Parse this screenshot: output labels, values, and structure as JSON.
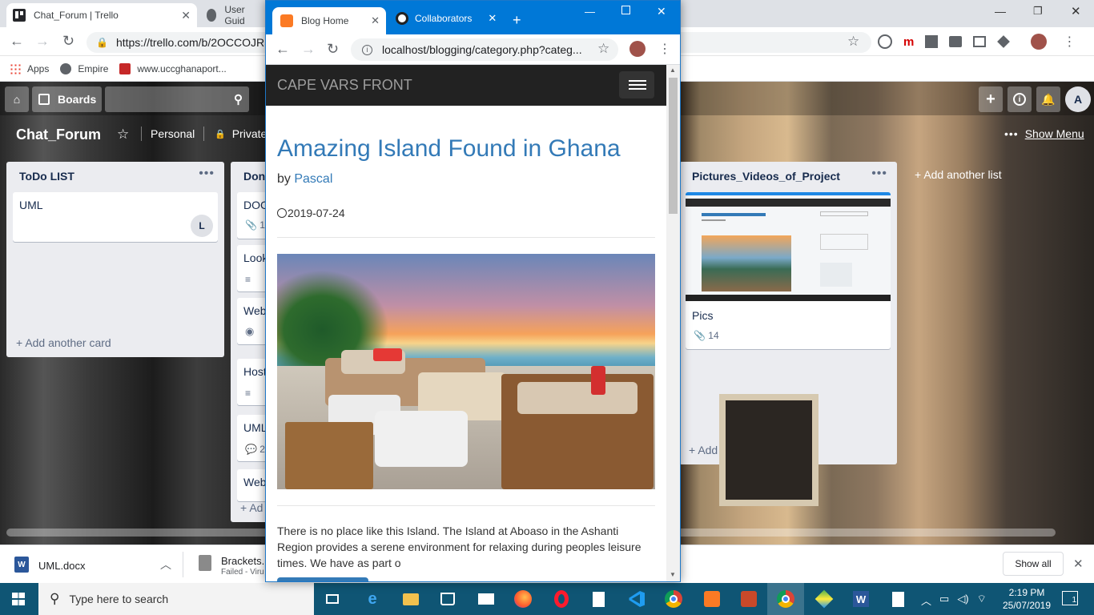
{
  "main_browser": {
    "tabs": [
      {
        "label": "Chat_Forum | Trello",
        "active": true
      },
      {
        "label": "User Guid",
        "active": false
      }
    ],
    "url": "https://trello.com/b/2OCCOJRS",
    "bookmarks": [
      {
        "label": "Apps",
        "icon": "apps-grid-icon"
      },
      {
        "label": "Empire",
        "icon": "globe-icon"
      },
      {
        "label": "www.uccghanaport...",
        "icon": "ucc-crest-icon"
      }
    ]
  },
  "trello": {
    "header": {
      "boards_label": "Boards",
      "avatar": "A"
    },
    "board": {
      "title": "Chat_Forum",
      "team": "Personal",
      "visibility": "Private",
      "show_menu": "Show Menu",
      "add_another_list": "Add another list"
    },
    "lists": [
      {
        "title": "ToDo LIST",
        "cards": [
          {
            "title": "UML",
            "member": "L"
          }
        ],
        "add_card": "Add another card"
      },
      {
        "title": "Don",
        "cards": [
          {
            "title": "DOC",
            "badge_icon": "paperclip-icon",
            "badge": "1"
          },
          {
            "title": "Look",
            "badge_icon": "description-icon"
          },
          {
            "title": "Web",
            "badge_icon": "eye-icon"
          },
          {
            "title": "Host",
            "badge_icon": "description-icon"
          },
          {
            "title": "UML",
            "badge_icon": "comment-icon",
            "badge": "2"
          },
          {
            "title": "Web"
          }
        ],
        "add_card": "Ad"
      },
      {
        "title": "Pictures_Videos_of_Project",
        "cards": [
          {
            "title": "Pics",
            "badge_icon": "paperclip-icon",
            "badge": "14"
          }
        ],
        "add_card": "Add another card"
      }
    ]
  },
  "popup": {
    "tabs": [
      {
        "label": "Blog Home",
        "active": true
      },
      {
        "label": "Collaborators",
        "active": false
      }
    ],
    "url": "localhost/blogging/category.php?categ...",
    "site": {
      "brand": "CAPE VARS FRONT",
      "post": {
        "title": "Amazing Island Found in Ghana",
        "by": "by",
        "author": "Pascal",
        "date": "2019-07-24",
        "excerpt": "There is no place like this Island. The Island at Aboaso in the Ashanti Region provides a serene environment for relaxing during peoples leisure times. We have as part o"
      }
    }
  },
  "downloads": {
    "items": [
      {
        "name": "UML.docx"
      },
      {
        "name": "Brackets.R",
        "status": "Failed - Viru"
      }
    ],
    "show_all": "Show all"
  },
  "taskbar": {
    "search_placeholder": "Type here to search",
    "time": "2:19 PM",
    "date": "25/07/2019",
    "notifications": "1"
  },
  "colors": {
    "trello_blue": "#0079bf",
    "popup_accent": "#0078d7",
    "link_blue": "#337ab7",
    "taskbar": "#0f5574"
  }
}
